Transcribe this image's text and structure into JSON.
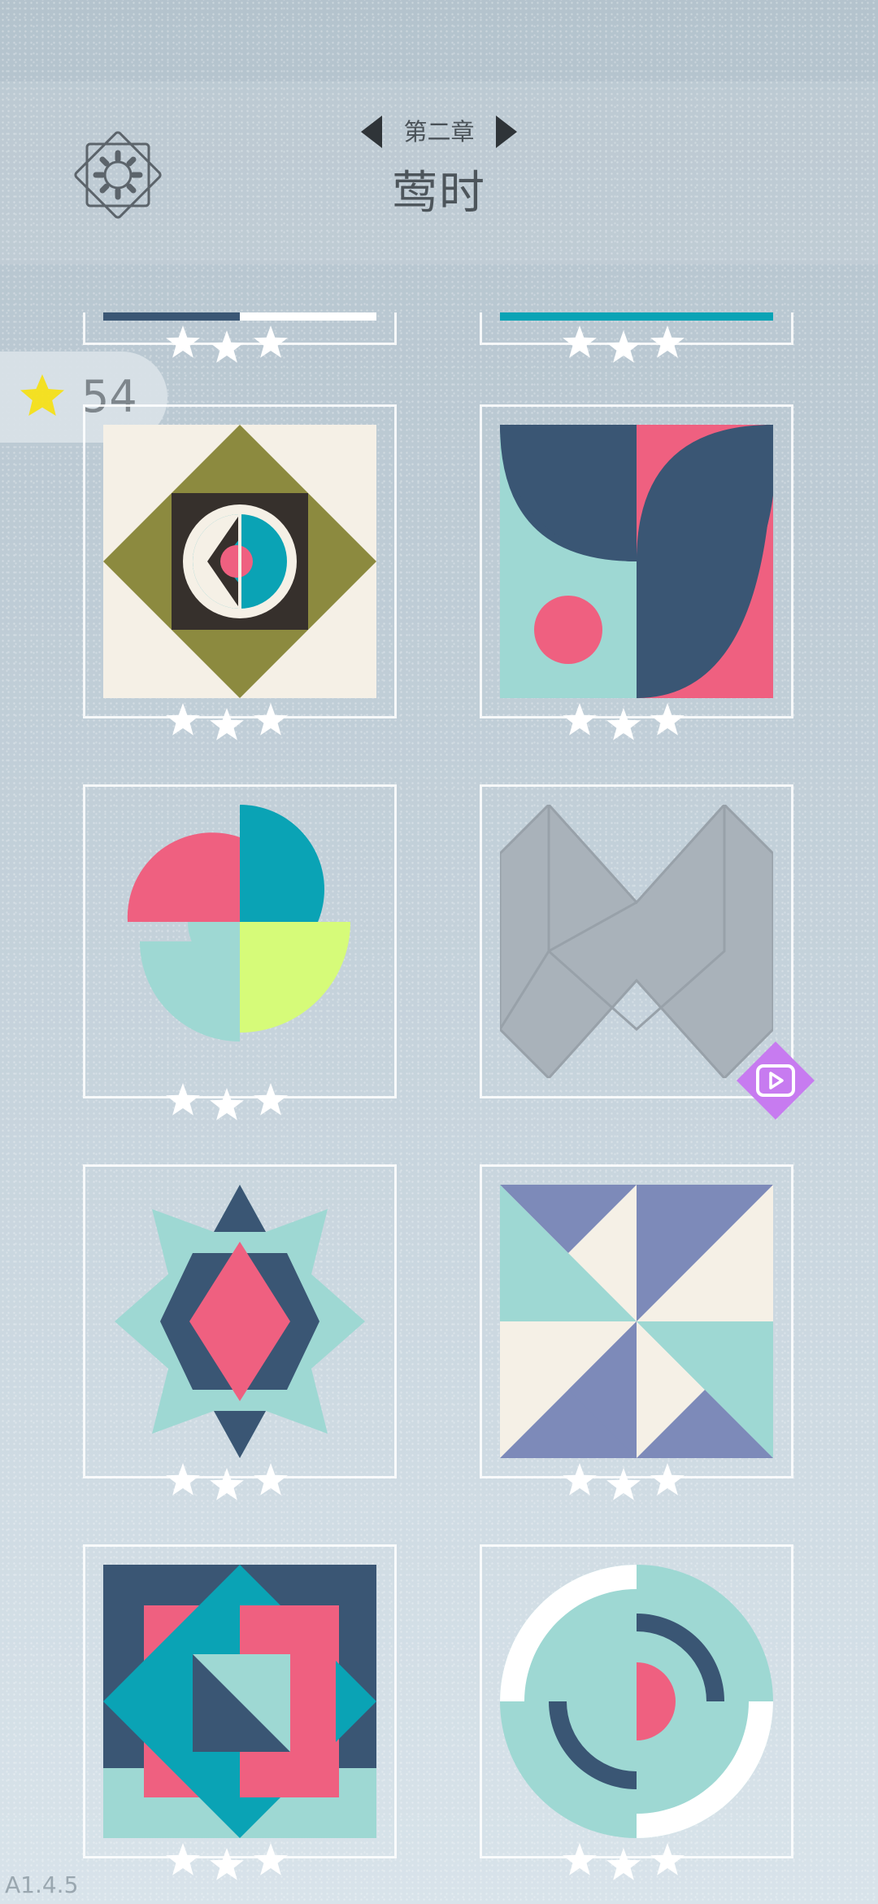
{
  "header": {
    "chapter_label": "第二章",
    "chapter_title": "莺时"
  },
  "stars_total": "54",
  "levels": [
    {
      "row": 0,
      "name": "partial-left",
      "progress": 0.5,
      "stars": 3
    },
    {
      "row": 0,
      "name": "partial-right",
      "progress": 1.0,
      "stars": 3
    },
    {
      "name": "diamond-eye",
      "stars": 3
    },
    {
      "name": "butterfly-tiles",
      "stars": 3
    },
    {
      "name": "pinwheel-circle",
      "stars": 3
    },
    {
      "name": "locked-zigzag",
      "stars": 0,
      "locked": true
    },
    {
      "name": "hexagram",
      "stars": 3
    },
    {
      "name": "triangle-pinwheel",
      "stars": 3
    },
    {
      "name": "nested-squares",
      "stars": 3
    },
    {
      "name": "concentric-rings",
      "stars": 3
    }
  ],
  "colors": {
    "navy": "#3a5674",
    "teal": "#0aa3b5",
    "mint": "#9ed8d3",
    "pink": "#ef6080",
    "cream": "#f5f0e6",
    "olive": "#8c8a3f",
    "dark": "#36302c",
    "lime": "#d6fb79",
    "periwinkle": "#7d8ab9",
    "gold": "#f7e21a",
    "purple": "#c77bf0"
  },
  "icons": {
    "settings": "gear-icon",
    "prev": "triangle-left-icon",
    "next": "triangle-right-icon",
    "star": "star-icon",
    "ad": "play-video-icon"
  },
  "version": "A1.4.5"
}
